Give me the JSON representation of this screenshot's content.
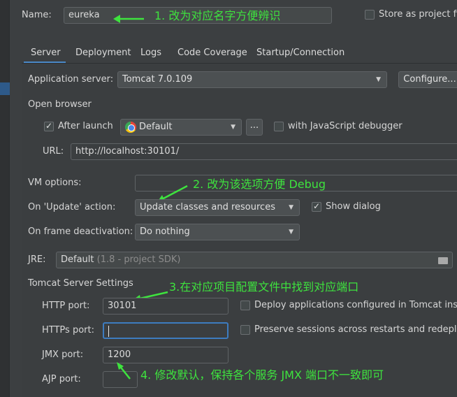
{
  "name": {
    "label": "Name:",
    "value": "eureka"
  },
  "store_project_file": {
    "label": "Store as project fil",
    "checked": false
  },
  "tabs": [
    {
      "label": "Server",
      "active": true
    },
    {
      "label": "Deployment"
    },
    {
      "label": "Logs"
    },
    {
      "label": "Code Coverage"
    },
    {
      "label": "Startup/Connection"
    }
  ],
  "app_server": {
    "label": "Application server:",
    "value": "Tomcat 7.0.109",
    "configure_label": "Configure..."
  },
  "open_browser": {
    "section_label": "Open browser",
    "after_launch": {
      "label": "After launch",
      "checked": true
    },
    "browser": {
      "value": "Default",
      "icon": "chrome-icon"
    },
    "more_label": "...",
    "js_debugger": {
      "label": "with JavaScript debugger",
      "checked": false
    },
    "url_label": "URL:",
    "url_value": "http://localhost:30101/"
  },
  "vm_options": {
    "label": "VM options:",
    "value": ""
  },
  "on_update": {
    "label": "On 'Update' action:",
    "value": "Update classes and resources"
  },
  "show_dialog": {
    "label": "Show dialog",
    "checked": true
  },
  "on_frame": {
    "label": "On frame deactivation:",
    "value": "Do nothing"
  },
  "jre": {
    "label": "JRE:",
    "value": "Default",
    "hint": "(1.8 - project SDK)"
  },
  "tomcat": {
    "section_label": "Tomcat Server Settings",
    "http_label": "HTTP port:",
    "http_value": "30101",
    "deploy_label": "Deploy applications configured in Tomcat instar",
    "https_label": "HTTPs port:",
    "https_value": "",
    "preserve_label": "Preserve sessions across restarts and redeploy",
    "jmx_label": "JMX port:",
    "jmx_value": "1200",
    "ajp_label": "AJP port:",
    "ajp_value": ""
  },
  "annotations": {
    "a1": "1. 改为对应名字方便辨识",
    "a2": "2. 改为该选项方便 Debug",
    "a3": "3.在对应项目配置文件中找到对应端口",
    "a4": "4. 修改默认，保持各个服务 JMX 端口不一致即可"
  },
  "colors": {
    "annotation": "#3ee33e",
    "tab_accent": "#4a88c7",
    "background": "#3c3f41"
  }
}
